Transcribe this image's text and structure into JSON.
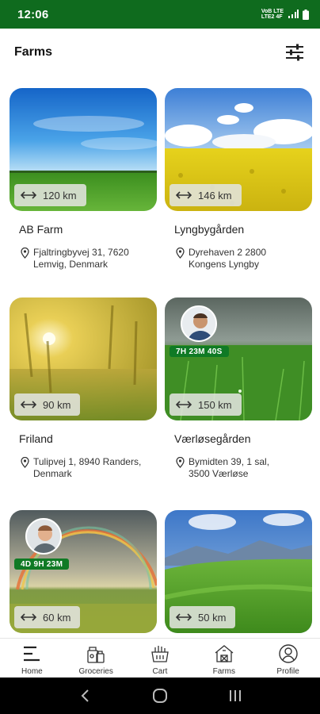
{
  "status_bar": {
    "time": "12:06",
    "network_line1": "VoB LTE",
    "network_line2": "LTE2 4F"
  },
  "header": {
    "title": "Farms",
    "filter_icon": "sliders-icon"
  },
  "farms": [
    {
      "name": "AB Farm",
      "distance": "120 km",
      "address_line1": "Fjaltringbyvej 31, 7620",
      "address_line2": "Lemvig, Denmark"
    },
    {
      "name": "Lyngbygården",
      "distance": "146 km",
      "address_line1": "Dyrehaven 2 2800",
      "address_line2": "Kongens Lyngby"
    },
    {
      "name": "Friland",
      "distance": "90 km",
      "address_line1": "Tulipvej 1, 8940 Randers,",
      "address_line2": "Denmark"
    },
    {
      "name": "Værløsegården",
      "distance": "150 km",
      "address_line1": "Bymidten 39, 1 sal,",
      "address_line2": "3500 Værløse",
      "timer": "7H 23M 40S"
    },
    {
      "name": "",
      "distance": "60 km",
      "timer": "4D 9H 23M"
    },
    {
      "name": "",
      "distance": "50 km"
    }
  ],
  "bottom_nav": [
    {
      "label": "Home",
      "icon": "menu-icon"
    },
    {
      "label": "Groceries",
      "icon": "groceries-icon"
    },
    {
      "label": "Cart",
      "icon": "cart-icon"
    },
    {
      "label": "Farms",
      "icon": "barn-icon"
    },
    {
      "label": "Profile",
      "icon": "profile-icon"
    }
  ],
  "colors": {
    "brand_green": "#0f6b1e",
    "timer_green": "#0f7a25"
  }
}
